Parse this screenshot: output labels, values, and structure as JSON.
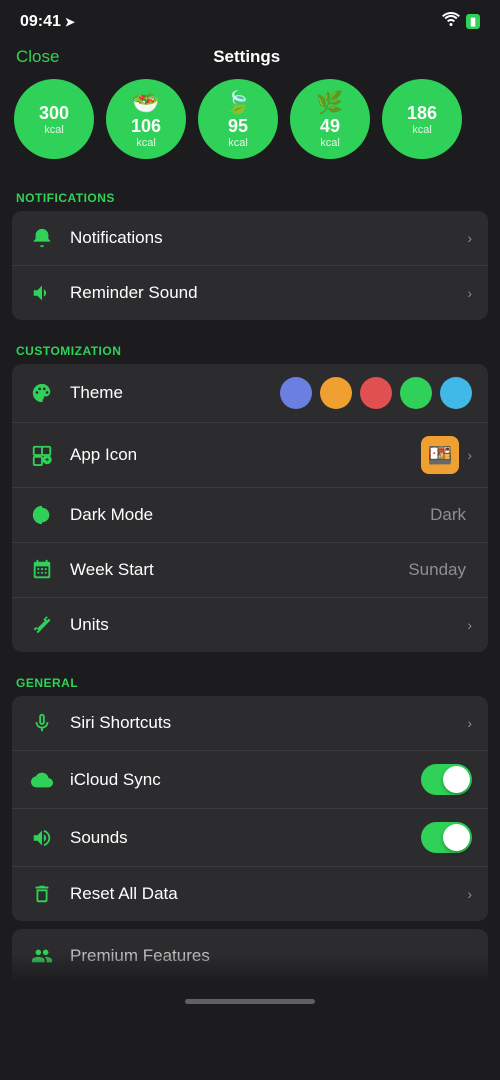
{
  "statusBar": {
    "time": "09:41",
    "locationIcon": "➤",
    "wifiLabel": "wifi",
    "batteryLabel": "■"
  },
  "navBar": {
    "closeLabel": "Close",
    "title": "Settings"
  },
  "foodCircles": [
    {
      "id": "fc1",
      "value": "300",
      "unit": "kcal",
      "type": "value"
    },
    {
      "id": "fc2",
      "value": "106",
      "unit": "kcal",
      "type": "icon"
    },
    {
      "id": "fc3",
      "value": "95",
      "unit": "kcal",
      "type": "icon"
    },
    {
      "id": "fc4",
      "value": "49",
      "unit": "kcal",
      "type": "icon"
    },
    {
      "id": "fc5",
      "value": "186",
      "unit": "kcal",
      "type": "value"
    }
  ],
  "sections": {
    "notifications": {
      "header": "NOTIFICATIONS",
      "items": [
        {
          "id": "notifications",
          "label": "Notifications",
          "iconType": "bell",
          "hasChevron": true
        },
        {
          "id": "reminder-sound",
          "label": "Reminder Sound",
          "iconType": "speaker",
          "hasChevron": true
        }
      ]
    },
    "customization": {
      "header": "CUSTOMIZATION",
      "items": [
        {
          "id": "theme",
          "label": "Theme",
          "iconType": "palette",
          "hasChevron": false,
          "themeColors": [
            "#6a7fe0",
            "#f0a030",
            "#e05050",
            "#30d158",
            "#40b8e8"
          ]
        },
        {
          "id": "app-icon",
          "label": "App Icon",
          "iconType": "appicon",
          "hasChevron": true,
          "iconPreview": "🍱"
        },
        {
          "id": "dark-mode",
          "label": "Dark Mode",
          "iconType": "halfcircle",
          "hasChevron": false,
          "value": "Dark"
        },
        {
          "id": "week-start",
          "label": "Week Start",
          "iconType": "calendar",
          "hasChevron": false,
          "value": "Sunday"
        },
        {
          "id": "units",
          "label": "Units",
          "iconType": "ruler",
          "hasChevron": true
        }
      ]
    },
    "general": {
      "header": "GENERAL",
      "items": [
        {
          "id": "siri",
          "label": "Siri Shortcuts",
          "iconType": "mic",
          "hasChevron": true
        },
        {
          "id": "icloud",
          "label": "iCloud Sync",
          "iconType": "cloud",
          "hasChevron": false,
          "toggle": true,
          "toggleOn": true
        },
        {
          "id": "sounds",
          "label": "Sounds",
          "iconType": "speaker2",
          "hasChevron": false,
          "toggle": true,
          "toggleOn": true
        },
        {
          "id": "reset",
          "label": "Reset All Data",
          "iconType": "trash",
          "hasChevron": true
        }
      ]
    }
  },
  "premiumRow": {
    "label": "Premium Features"
  },
  "accentColor": "#30d158"
}
